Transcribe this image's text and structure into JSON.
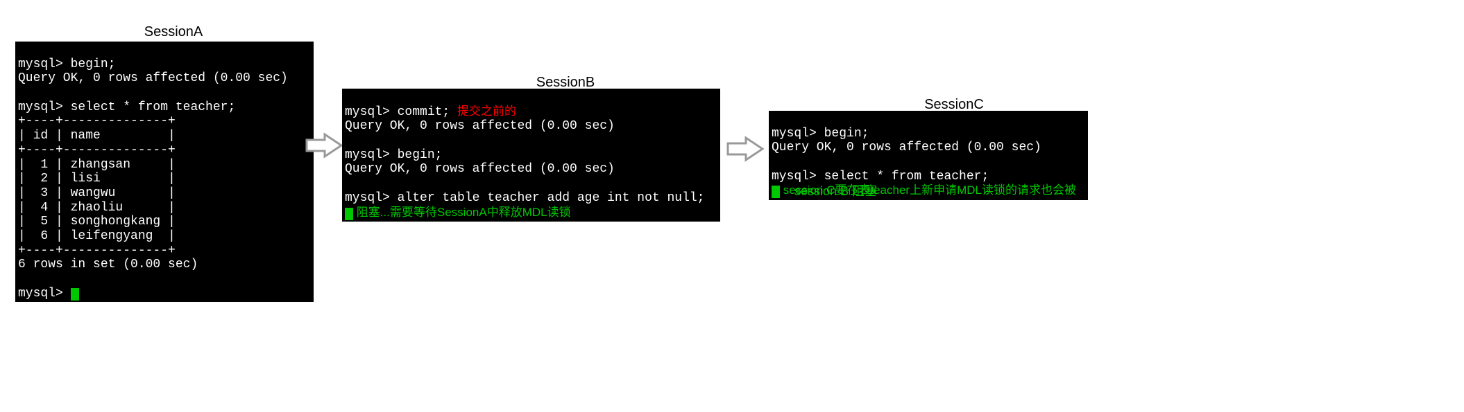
{
  "sessionA": {
    "label": "SessionA",
    "lines": {
      "begin": "mysql> begin;",
      "ok1": "Query OK, 0 rows affected (0.00 sec)",
      "select": "mysql> select * from teacher;",
      "border": "+----+--------------+",
      "header": "| id | name         |",
      "row1": "|  1 | zhangsan     |",
      "row2": "|  2 | lisi         |",
      "row3": "|  3 | wangwu       |",
      "row4": "|  4 | zhaoliu      |",
      "row5": "|  5 | songhongkang |",
      "row6": "|  6 | leifengyang  |",
      "rowsinset": "6 rows in set (0.00 sec)",
      "prompt": "mysql> "
    }
  },
  "sessionB": {
    "label": "SessionB",
    "lines": {
      "commit": "mysql> commit;",
      "commit_note": "提交之前的",
      "ok1": "Query OK, 0 rows affected (0.00 sec)",
      "begin": "mysql> begin;",
      "ok2": "Query OK, 0 rows affected (0.00 sec)",
      "alter": "mysql> alter table teacher add age int not null;",
      "block_note": " 阻塞...需要等待SessionA中释放MDL读锁"
    }
  },
  "sessionC": {
    "label": "SessionC",
    "lines": {
      "begin": "mysql> begin;",
      "ok1": "Query OK, 0 rows affected (0.00 sec)",
      "select": "mysql> select * from teacher;",
      "note1": " session C要在表teacher上新申请MDL读锁的请求也会被",
      "note2": "session B 阻塞"
    }
  }
}
